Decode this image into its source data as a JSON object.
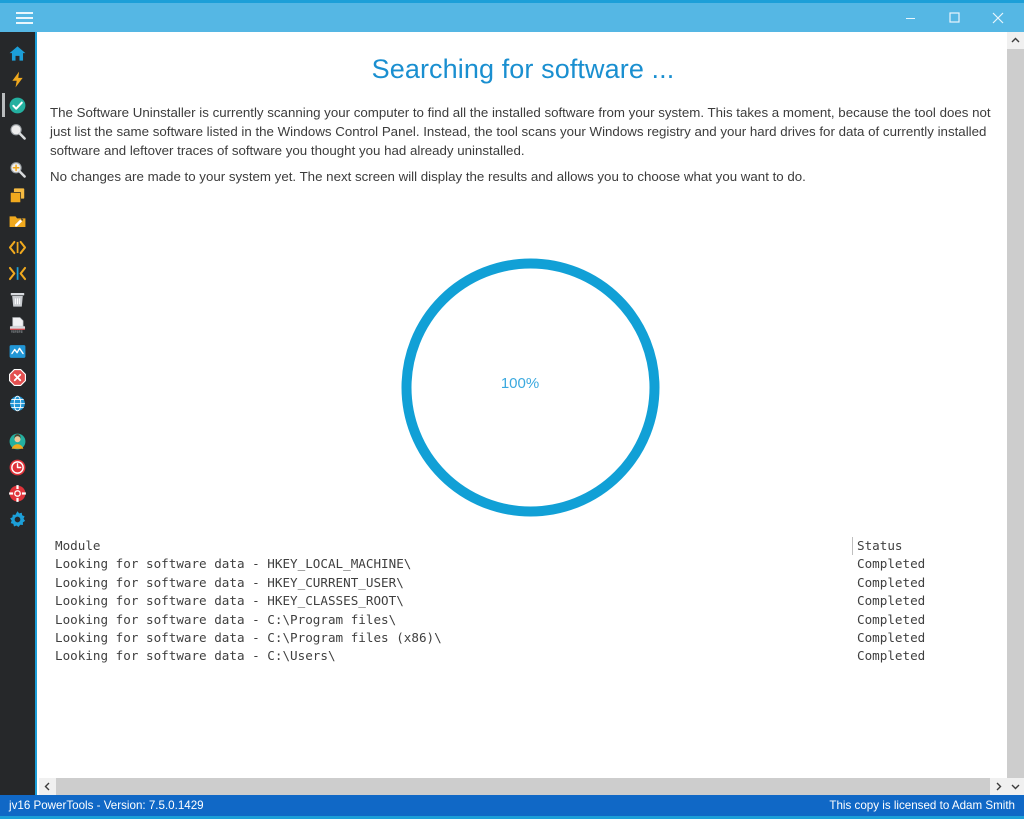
{
  "window": {
    "menu_icon": "hamburger-menu-icon",
    "minimize_label": "Minimize",
    "maximize_label": "Maximize",
    "close_label": "Close",
    "accent_color": "#1c9fd8",
    "titlebar_color": "#55b7e4"
  },
  "sidebar": {
    "background_color": "#26282a",
    "items": [
      {
        "name": "home",
        "icon": "home-icon",
        "label": "Home",
        "color": "#1c9fd8",
        "selected": false
      },
      {
        "name": "quick-actions",
        "icon": "lightning-bolt-icon",
        "label": "Quick Actions",
        "color": "#f0a91e",
        "selected": false
      },
      {
        "name": "clean-and-fix",
        "icon": "check-circle-icon",
        "label": "Clean and Fix my Computer",
        "color": "#24b0a0",
        "selected": true
      },
      {
        "name": "find-software",
        "icon": "magnifier-icon",
        "label": "Software Uninstaller",
        "color": "#e8e8e8",
        "selected": false
      },
      {
        "name": "search-files",
        "icon": "magnifier-plus-icon",
        "label": "Search Files",
        "color": "#f0a91e",
        "selected": false
      },
      {
        "name": "duplicate-files",
        "icon": "duplicate-files-icon",
        "label": "Duplicate File Finder",
        "color": "#f0a91e",
        "selected": false
      },
      {
        "name": "file-organizer",
        "icon": "folder-edit-icon",
        "label": "File Organizer",
        "color": "#f0a91e",
        "selected": false
      },
      {
        "name": "registry-tools",
        "icon": "code-brackets-icon",
        "label": "Registry Tools",
        "color": "#f0a91e",
        "selected": false
      },
      {
        "name": "registry-compactor",
        "icon": "merge-arrows-icon",
        "label": "Registry Compactor",
        "color": "#f0a91e",
        "selected": false
      },
      {
        "name": "uninstaller",
        "icon": "trash-bin-icon",
        "label": "Uninstaller",
        "color": "#c9ccd0",
        "selected": false
      },
      {
        "name": "file-shredder",
        "icon": "shredder-icon",
        "label": "File Shredder",
        "color": "#e2e4e6",
        "selected": false
      },
      {
        "name": "system-monitor",
        "icon": "monitor-chart-icon",
        "label": "System Monitor",
        "color": "#2196d6",
        "selected": false
      },
      {
        "name": "startup-manager",
        "icon": "stop-sign-icon",
        "label": "Startup Manager",
        "color": "#e35050",
        "selected": false
      },
      {
        "name": "internet-optimizer",
        "icon": "globe-icon",
        "label": "Internet Optimizer",
        "color": "#2196d6",
        "selected": false
      },
      {
        "name": "privacy-protector",
        "icon": "user-avatar-icon",
        "label": "Privacy Protector",
        "color": "#24b0a0",
        "selected": false
      },
      {
        "name": "history-cleaner",
        "icon": "clock-icon",
        "label": "History Cleaner",
        "color": "#e0333a",
        "selected": false
      },
      {
        "name": "support",
        "icon": "lifebuoy-icon",
        "label": "Support",
        "color": "#e0333a",
        "selected": false
      },
      {
        "name": "settings",
        "icon": "gear-icon",
        "label": "Settings",
        "color": "#1c9fd8",
        "selected": false
      }
    ]
  },
  "main": {
    "title": "Searching for software ...",
    "paragraphs": [
      "The Software Uninstaller is currently scanning your computer to find all the installed software from your system. This takes a moment, because the tool does not just list the same software listed in the Windows Control Panel. Instead, the tool scans your Windows registry and your hard drives for data of currently installed software and leftover traces of software you thought you had already uninstalled.",
      "No changes are made to your system yet. The next screen will display the results and allows you to choose what you want to do."
    ],
    "progress": {
      "percent_label": "100%",
      "percent_value": 100,
      "ring_color": "#11a0d6",
      "track_color": "#ffffff"
    },
    "table": {
      "headers": {
        "module": "Module",
        "status": "Status"
      },
      "rows": [
        {
          "module": "Looking for software data - HKEY_LOCAL_MACHINE\\",
          "status": "Completed"
        },
        {
          "module": "Looking for software data - HKEY_CURRENT_USER\\",
          "status": "Completed"
        },
        {
          "module": "Looking for software data - HKEY_CLASSES_ROOT\\",
          "status": "Completed"
        },
        {
          "module": "Looking for software data - C:\\Program files\\",
          "status": "Completed"
        },
        {
          "module": "Looking for software data - C:\\Program files (x86)\\",
          "status": "Completed"
        },
        {
          "module": "Looking for software data - C:\\Users\\",
          "status": "Completed"
        }
      ]
    }
  },
  "scrollbars": {
    "vertical_up": "scroll-up-arrow-icon",
    "vertical_down": "scroll-down-arrow-icon",
    "horizontal_left": "scroll-left-arrow-icon",
    "horizontal_right": "scroll-right-arrow-icon"
  },
  "statusbar": {
    "left_text": "jv16 PowerTools - Version: 7.5.0.1429",
    "right_text": "This copy is licensed to Adam Smith",
    "background_color": "#1068c6"
  }
}
